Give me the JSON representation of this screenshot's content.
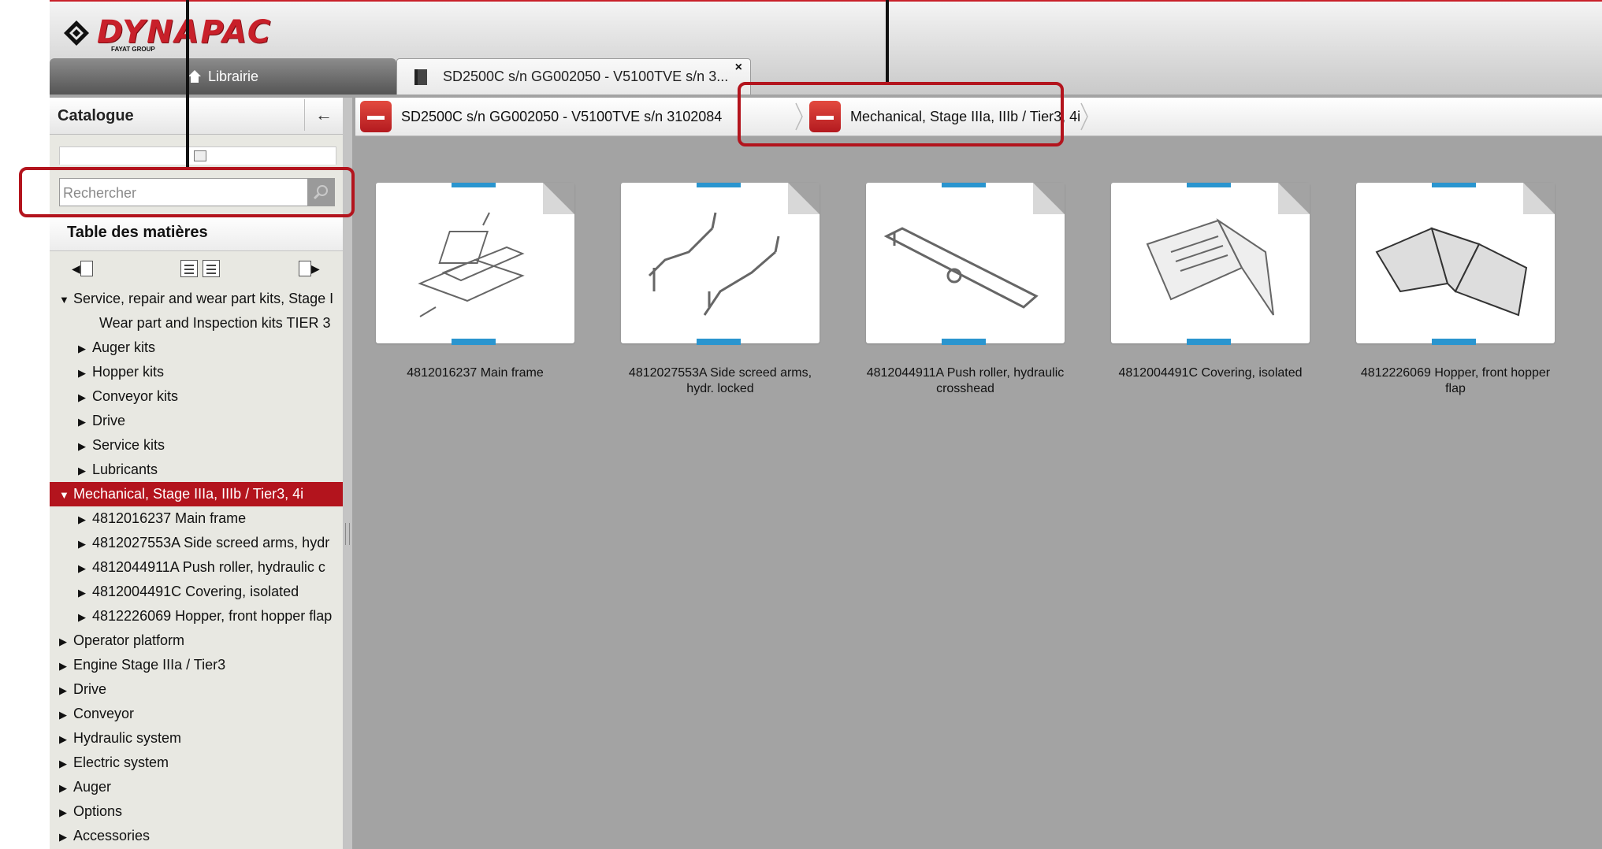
{
  "brand": {
    "name": "DYNAPAC",
    "sub": "FAYAT GROUP"
  },
  "tabs": {
    "library": "Librairie",
    "document": "SD2500C s/n GG002050 - V5100TVE s/n 3...",
    "close": "×"
  },
  "catalog": {
    "title": "Catalogue",
    "collapse": "←"
  },
  "search": {
    "placeholder": "Rechercher"
  },
  "toc": {
    "title": "Table des matières"
  },
  "tree": [
    {
      "label": "Service, repair and wear part kits, Stage I",
      "level": 0,
      "arrow": "▼"
    },
    {
      "label": "Wear part and Inspection kits TIER 3",
      "level": 1,
      "arrow": ""
    },
    {
      "label": "Auger kits",
      "level": 1,
      "arrow": "▶"
    },
    {
      "label": "Hopper kits",
      "level": 1,
      "arrow": "▶"
    },
    {
      "label": "Conveyor kits",
      "level": 1,
      "arrow": "▶"
    },
    {
      "label": "Drive",
      "level": 1,
      "arrow": "▶"
    },
    {
      "label": "Service kits",
      "level": 1,
      "arrow": "▶"
    },
    {
      "label": "Lubricants",
      "level": 1,
      "arrow": "▶"
    },
    {
      "label": "Mechanical,  Stage IIIa, IIIb / Tier3, 4i",
      "level": 0,
      "arrow": "▼",
      "selected": true
    },
    {
      "label": "4812016237 Main frame",
      "level": 1,
      "arrow": "▶"
    },
    {
      "label": "4812027553A Side screed arms, hydr",
      "level": 1,
      "arrow": "▶"
    },
    {
      "label": "4812044911A Push roller, hydraulic c",
      "level": 1,
      "arrow": "▶"
    },
    {
      "label": "4812004491C Covering, isolated",
      "level": 1,
      "arrow": "▶"
    },
    {
      "label": "4812226069 Hopper, front hopper flap",
      "level": 1,
      "arrow": "▶"
    },
    {
      "label": "Operator platform",
      "level": 0,
      "arrow": "▶"
    },
    {
      "label": "Engine  Stage IIIa / Tier3",
      "level": 0,
      "arrow": "▶"
    },
    {
      "label": "Drive",
      "level": 0,
      "arrow": "▶"
    },
    {
      "label": "Conveyor",
      "level": 0,
      "arrow": "▶"
    },
    {
      "label": "Hydraulic system",
      "level": 0,
      "arrow": "▶"
    },
    {
      "label": "Electric system",
      "level": 0,
      "arrow": "▶"
    },
    {
      "label": "Auger",
      "level": 0,
      "arrow": "▶"
    },
    {
      "label": "Options",
      "level": 0,
      "arrow": "▶"
    },
    {
      "label": "Accessories",
      "level": 0,
      "arrow": "▶"
    }
  ],
  "breadcrumb": [
    {
      "label": "SD2500C s/n GG002050 - V5100TVE s/n 3102084"
    },
    {
      "label": "Mechanical,  Stage IIIa, IIIb / Tier3, 4i"
    }
  ],
  "thumbnails": [
    {
      "caption": "4812016237 Main frame"
    },
    {
      "caption": "4812027553A Side screed arms, hydr. locked"
    },
    {
      "caption": "4812044911A Push roller, hydraulic crosshead"
    },
    {
      "caption": "4812004491C Covering, isolated"
    },
    {
      "caption": "4812226069 Hopper, front hopper flap"
    }
  ],
  "colors": {
    "accent": "#b3141d",
    "brand_red": "#c8202a",
    "content_bg": "#a3a3a3",
    "thumb_tab": "#2a95cf"
  }
}
